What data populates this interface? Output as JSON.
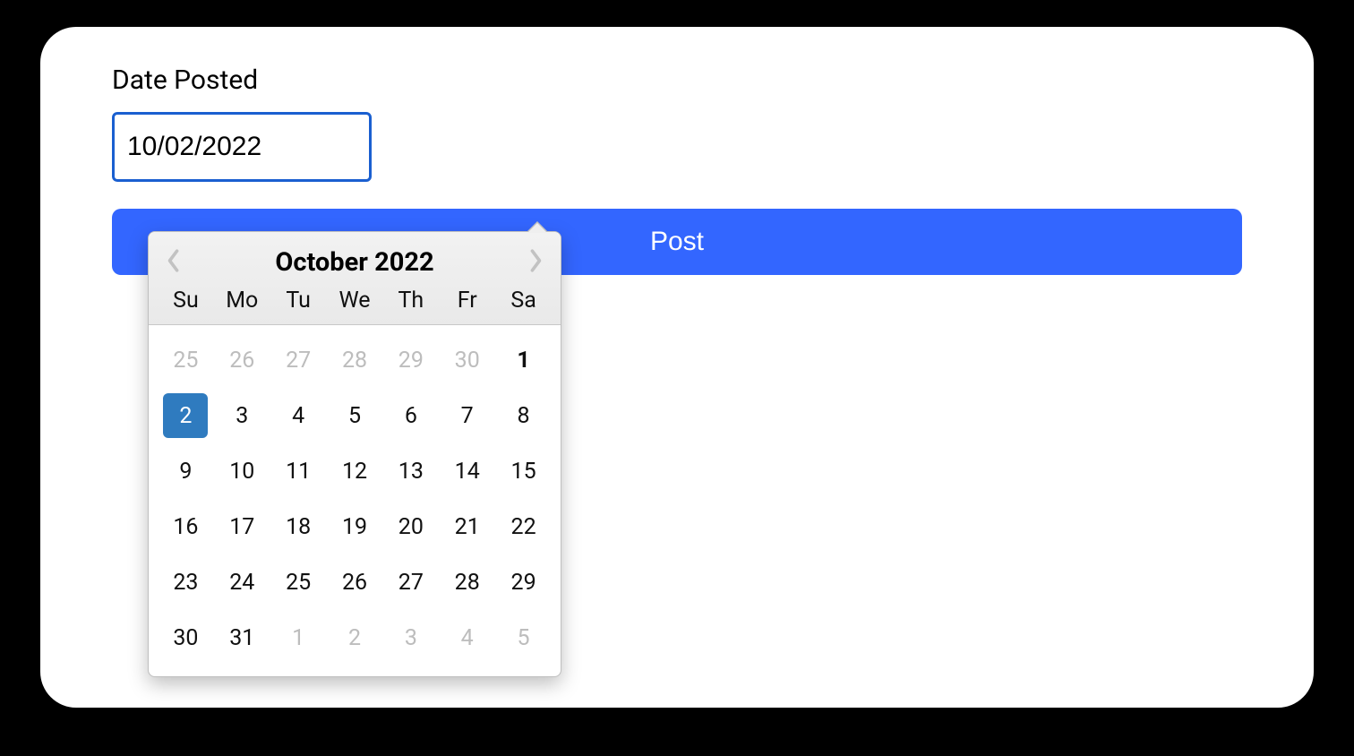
{
  "form": {
    "date_label": "Date Posted",
    "date_value": "10/02/2022",
    "post_button": "Post"
  },
  "datepicker": {
    "title": "October 2022",
    "dow": [
      "Su",
      "Mo",
      "Tu",
      "We",
      "Th",
      "Fr",
      "Sa"
    ],
    "weeks": [
      [
        {
          "d": "25",
          "other": true
        },
        {
          "d": "26",
          "other": true
        },
        {
          "d": "27",
          "other": true
        },
        {
          "d": "28",
          "other": true
        },
        {
          "d": "29",
          "other": true
        },
        {
          "d": "30",
          "other": true
        },
        {
          "d": "1",
          "bold": true
        }
      ],
      [
        {
          "d": "2",
          "selected": true
        },
        {
          "d": "3"
        },
        {
          "d": "4"
        },
        {
          "d": "5"
        },
        {
          "d": "6"
        },
        {
          "d": "7"
        },
        {
          "d": "8"
        }
      ],
      [
        {
          "d": "9"
        },
        {
          "d": "10"
        },
        {
          "d": "11"
        },
        {
          "d": "12"
        },
        {
          "d": "13"
        },
        {
          "d": "14"
        },
        {
          "d": "15"
        }
      ],
      [
        {
          "d": "16"
        },
        {
          "d": "17"
        },
        {
          "d": "18"
        },
        {
          "d": "19"
        },
        {
          "d": "20"
        },
        {
          "d": "21"
        },
        {
          "d": "22"
        }
      ],
      [
        {
          "d": "23"
        },
        {
          "d": "24"
        },
        {
          "d": "25"
        },
        {
          "d": "26"
        },
        {
          "d": "27"
        },
        {
          "d": "28"
        },
        {
          "d": "29"
        }
      ],
      [
        {
          "d": "30"
        },
        {
          "d": "31"
        },
        {
          "d": "1",
          "other": true
        },
        {
          "d": "2",
          "other": true
        },
        {
          "d": "3",
          "other": true
        },
        {
          "d": "4",
          "other": true
        },
        {
          "d": "5",
          "other": true
        }
      ]
    ]
  }
}
